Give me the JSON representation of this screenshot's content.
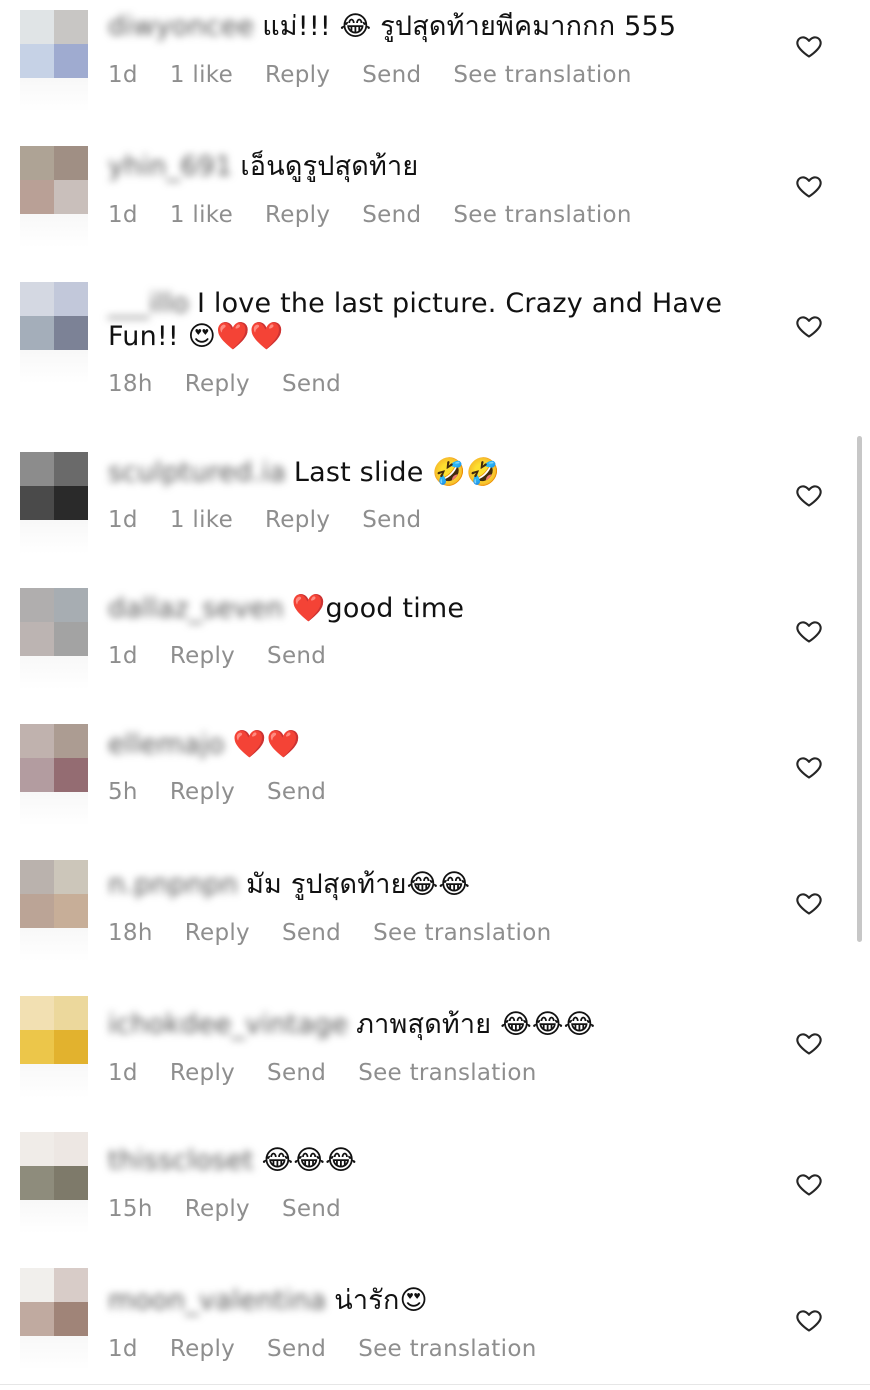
{
  "comments": [
    {
      "username": "diwyoncee",
      "text": "แม่!!! 😂 รูปสุดท้ายพีคมากกก 555",
      "time": "1d",
      "likes": "1 like",
      "reply": "Reply",
      "send": "Send",
      "translation": "See translation",
      "avatar_colors": [
        "#e0e4e6",
        "#c8c6c4",
        "#c6d2e6",
        "#9fabd0"
      ]
    },
    {
      "username": "yhin_691",
      "text": "เอ็นดูรูปสุดท้าย",
      "time": "1d",
      "likes": "1 like",
      "reply": "Reply",
      "send": "Send",
      "translation": "See translation",
      "avatar_colors": [
        "#aea395",
        "#a08f84",
        "#b9a096",
        "#c9bfbb"
      ]
    },
    {
      "username": "___illo",
      "text": "I love the last picture. Crazy and Have Fun!! 😍❤️❤️",
      "time": "18h",
      "likes": "",
      "reply": "Reply",
      "send": "Send",
      "translation": "",
      "avatar_colors": [
        "#d4d8e2",
        "#c2c8da",
        "#a4aeba",
        "#7c8296"
      ]
    },
    {
      "username": "sculptured.ia",
      "text": "Last slide 🤣🤣",
      "time": "1d",
      "likes": "1 like",
      "reply": "Reply",
      "send": "Send",
      "translation": "",
      "avatar_colors": [
        "#8c8c8c",
        "#6a6a6a",
        "#4a4a4a",
        "#2a2a2a"
      ]
    },
    {
      "username": "dallaz_seven",
      "text": "❤️good time",
      "time": "1d",
      "likes": "",
      "reply": "Reply",
      "send": "Send",
      "translation": "",
      "avatar_colors": [
        "#b0aeae",
        "#a7adb2",
        "#bcb4b2",
        "#a3a3a3"
      ]
    },
    {
      "username": "ellemajo",
      "text": "❤️❤️",
      "time": "5h",
      "likes": "",
      "reply": "Reply",
      "send": "Send",
      "translation": "",
      "avatar_colors": [
        "#c0b2ae",
        "#ac9c92",
        "#b39ca0",
        "#946c72"
      ]
    },
    {
      "username": "n.pnpnpn",
      "text": "มัม รูปสุดท้าย😂😂",
      "time": "18h",
      "likes": "",
      "reply": "Reply",
      "send": "Send",
      "translation": "See translation",
      "avatar_colors": [
        "#bab2ad",
        "#ccc6ba",
        "#bba496",
        "#c7ae98"
      ]
    },
    {
      "username": "ichokdee_vintage",
      "text": "ภาพสุดท้าย 😂😂😂",
      "time": "1d",
      "likes": "",
      "reply": "Reply",
      "send": "Send",
      "translation": "See translation",
      "avatar_colors": [
        "#f2e0b2",
        "#ecd89c",
        "#ecc64a",
        "#e2b22e"
      ]
    },
    {
      "username": "thisscloset",
      "text": "😂😂😂",
      "time": "15h",
      "likes": "",
      "reply": "Reply",
      "send": "Send",
      "translation": "",
      "avatar_colors": [
        "#f0ece8",
        "#ede7e3",
        "#8e8c7c",
        "#7e7a6a"
      ]
    },
    {
      "username": "moon_valentina",
      "text": "น่ารัก😍",
      "time": "1d",
      "likes": "",
      "reply": "Reply",
      "send": "Send",
      "translation": "See translation",
      "avatar_colors": [
        "#f1efec",
        "#d8ccc8",
        "#c0aaa0",
        "#a08478"
      ]
    }
  ]
}
